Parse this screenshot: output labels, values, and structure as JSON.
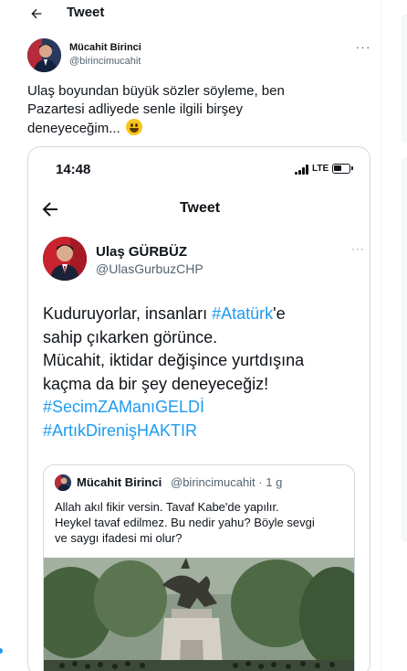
{
  "header": {
    "title": "Tweet"
  },
  "tweet": {
    "author_name": "Mücahit Birinci",
    "author_handle": "@birincimucahit",
    "text_lines": [
      "Ulaş boyundan büyük sözler söyleme, ben",
      "Pazartesi adliyede senle ilgili birşey",
      "deneyeceğim..."
    ],
    "emoji": "grinning-face-emoji"
  },
  "screenshot": {
    "status_time": "14:48",
    "network": "LTE",
    "nav_title": "Tweet",
    "author_name": "Ulaş GÜRBÜZ",
    "author_handle": "@UlasGurbuzCHP",
    "text": {
      "line1_a": "Kuduruyorlar, insanları ",
      "line1_tag": "#Atatürk",
      "line1_b": "'e",
      "line2": "sahip çıkarken görünce.",
      "line3": "Mücahit, iktidar değişince yurtdışına",
      "line4": "kaçma da bir şey deneyeceğiz!",
      "hashtag1": "#SecimZAManıGELDİ",
      "hashtag2": "#ArtıkDirenişHAKTIR"
    },
    "quote": {
      "author_name": "Mücahit Birinci",
      "author_handle": "@birincimucahit · 1 g",
      "text_lines": [
        "Allah akıl fikir versin. Tavaf Kabe'de yapılır.",
        "Heykel tavaf edilmez. Bu nedir yahu? Böyle sevgi",
        "ve saygı ifadesi mi olur?"
      ]
    }
  },
  "colors": {
    "accent": "#1d9bf0",
    "text_primary": "#0f1419",
    "text_secondary": "#536471",
    "border": "#cfd9de"
  }
}
